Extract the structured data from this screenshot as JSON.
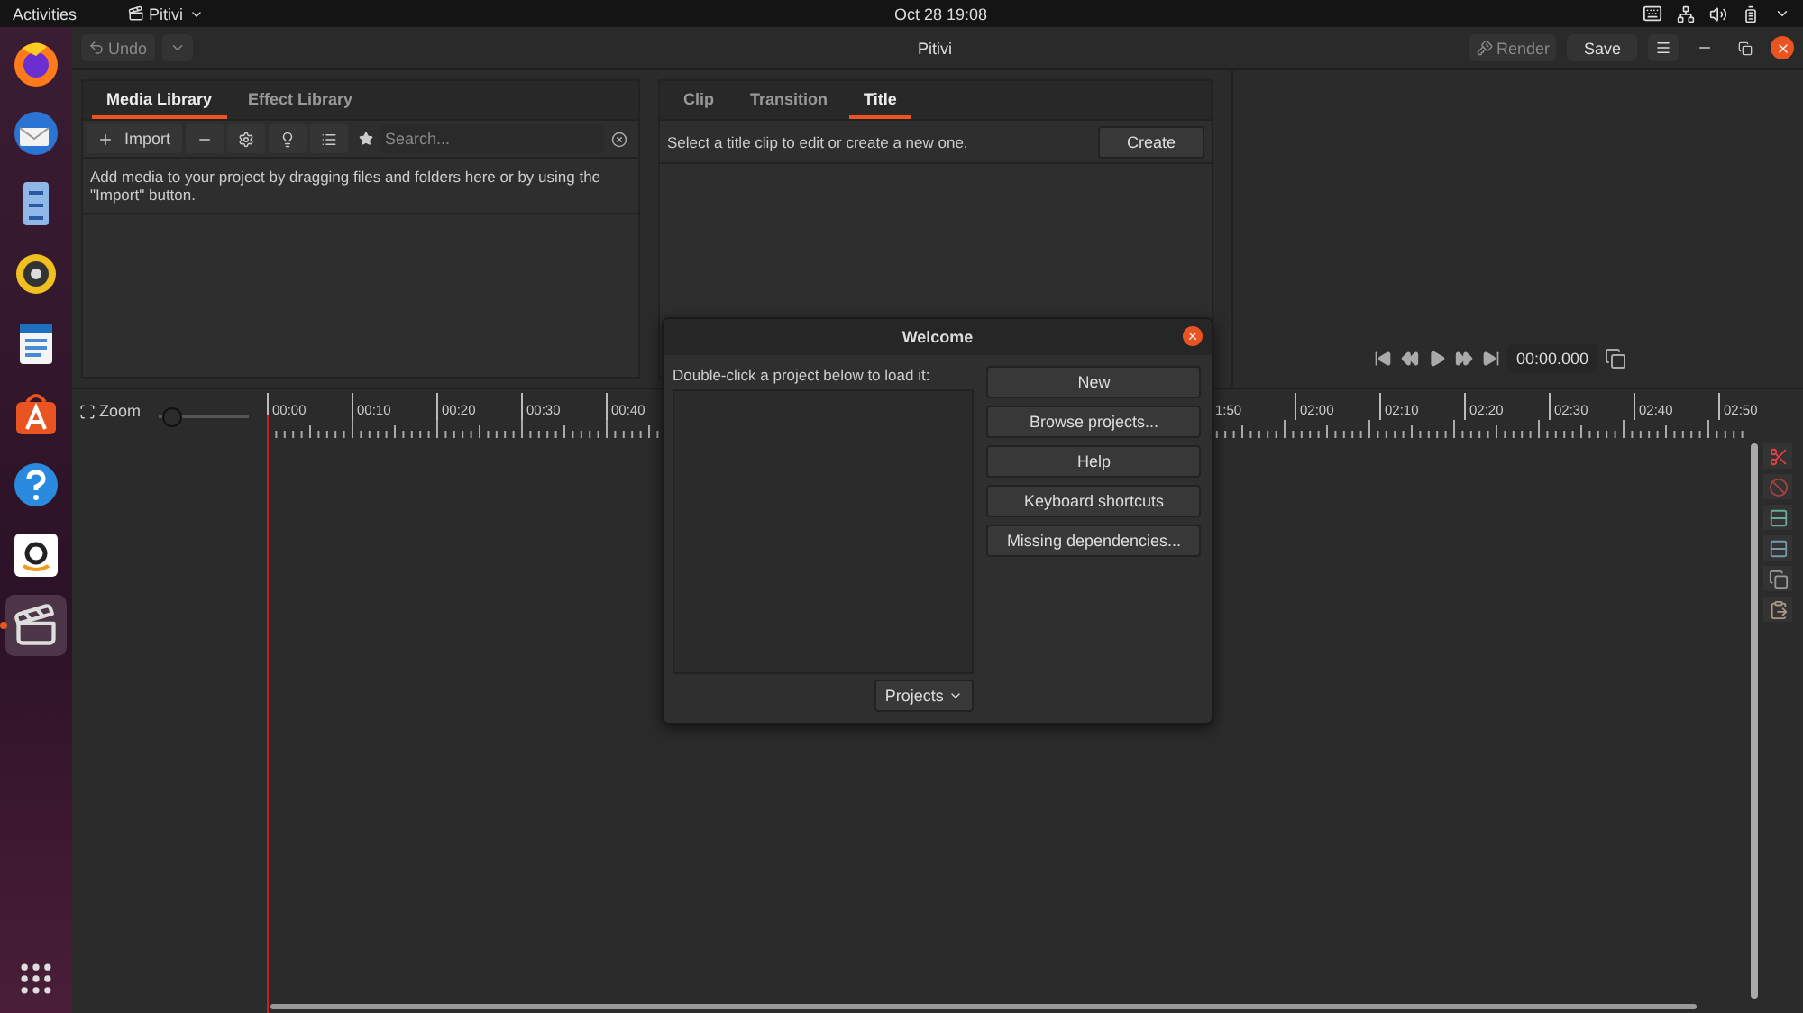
{
  "top_bar": {
    "activities": "Activities",
    "app_menu": "Pitivi",
    "clock": "Oct 28  19:08"
  },
  "dock": [
    {
      "kind": "browser",
      "selected": false
    },
    {
      "kind": "mail",
      "selected": false
    },
    {
      "kind": "files",
      "selected": false
    },
    {
      "kind": "music",
      "selected": false
    },
    {
      "kind": "document",
      "selected": false
    },
    {
      "kind": "store",
      "selected": false
    },
    {
      "kind": "help",
      "selected": false
    },
    {
      "kind": "shop",
      "selected": false
    },
    {
      "kind": "video",
      "selected": true
    }
  ],
  "header": {
    "undo": {
      "label": "Undo",
      "disabled": true
    },
    "title": "Pitivi",
    "render": {
      "label": "Render",
      "disabled": true
    },
    "save": "Save"
  },
  "media_library": {
    "tabs": [
      {
        "label": "Media Library",
        "selected": true
      },
      {
        "label": "Effect Library",
        "selected": false
      }
    ],
    "import": "Import",
    "search": {
      "placeholder": "Search..."
    },
    "hint": "Add media to your project by dragging files and folders here or by using the \"Import\" button."
  },
  "clip_panel": {
    "tabs": [
      {
        "label": "Clip",
        "selected": false
      },
      {
        "label": "Transition",
        "selected": false
      },
      {
        "label": "Title",
        "selected": true
      }
    ],
    "message": "Select a title clip to edit or create a new one.",
    "create": "Create"
  },
  "viewer": {
    "time": "00:00.000"
  },
  "timeline": {
    "zoom": "Zoom",
    "zoom_slider": {
      "level": 0.04
    },
    "ruler_left": [
      "00:00",
      "00:10",
      "00:20",
      "00:30",
      "00:40"
    ],
    "ruler_right": [
      "1:50",
      "02:00",
      "02:10",
      "02:20",
      "02:30",
      "02:40",
      "02:50"
    ]
  },
  "welcome": {
    "title": "Welcome",
    "prompt": "Double-click a project below to load it:",
    "buttons": [
      "New",
      "Browse projects...",
      "Help",
      "Keyboard shortcuts",
      "Missing dependencies..."
    ],
    "projects": "Projects"
  }
}
